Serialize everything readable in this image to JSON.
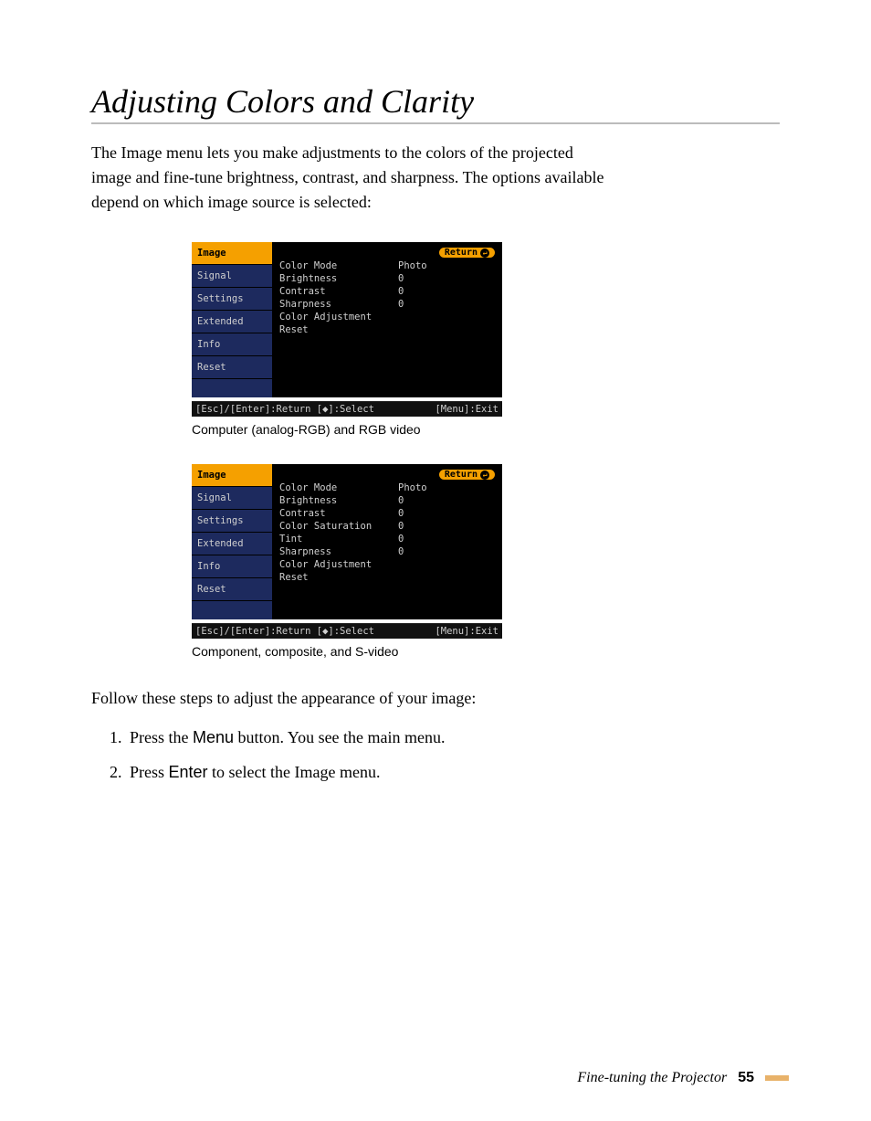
{
  "heading": "Adjusting Colors and Clarity",
  "intro": "The Image menu lets you make adjustments to the colors of the projected image and fine-tune brightness, contrast, and sharpness. The options available depend on which image source is selected:",
  "menu1": {
    "side": [
      "Image",
      "Signal",
      "Settings",
      "Extended",
      "Info",
      "Reset"
    ],
    "return": "Return",
    "rows": [
      {
        "lbl": "Color Mode",
        "val": "Photo"
      },
      {
        "lbl": "Brightness",
        "val": "0"
      },
      {
        "lbl": "Contrast",
        "val": "0"
      },
      {
        "lbl": "Sharpness",
        "val": "0"
      },
      {
        "lbl": "Color Adjustment",
        "val": ""
      },
      {
        "lbl": "Reset",
        "val": ""
      }
    ],
    "bottom_left": "[Esc]/[Enter]:Return [◆]:Select",
    "bottom_right": "[Menu]:Exit",
    "caption": "Computer (analog-RGB) and RGB video"
  },
  "menu2": {
    "side": [
      "Image",
      "Signal",
      "Settings",
      "Extended",
      "Info",
      "Reset"
    ],
    "return": "Return",
    "rows": [
      {
        "lbl": "Color Mode",
        "val": "Photo"
      },
      {
        "lbl": "Brightness",
        "val": "0"
      },
      {
        "lbl": "Contrast",
        "val": "0"
      },
      {
        "lbl": "Color Saturation",
        "val": "0"
      },
      {
        "lbl": "Tint",
        "val": "0"
      },
      {
        "lbl": "Sharpness",
        "val": "0"
      },
      {
        "lbl": "Color Adjustment",
        "val": ""
      },
      {
        "lbl": "Reset",
        "val": ""
      }
    ],
    "bottom_left": "[Esc]/[Enter]:Return [◆]:Select",
    "bottom_right": "[Menu]:Exit",
    "caption": "Component, composite, and S-video"
  },
  "steps_intro": "Follow these steps to adjust the appearance of your image:",
  "steps": {
    "s1_pre": "Press the ",
    "s1_btn": "Menu",
    "s1_post": " button. You see the main menu.",
    "s2_pre": "Press ",
    "s2_btn": "Enter",
    "s2_post": " to select the Image menu."
  },
  "footer": {
    "title": "Fine-tuning the Projector",
    "page": "55"
  }
}
